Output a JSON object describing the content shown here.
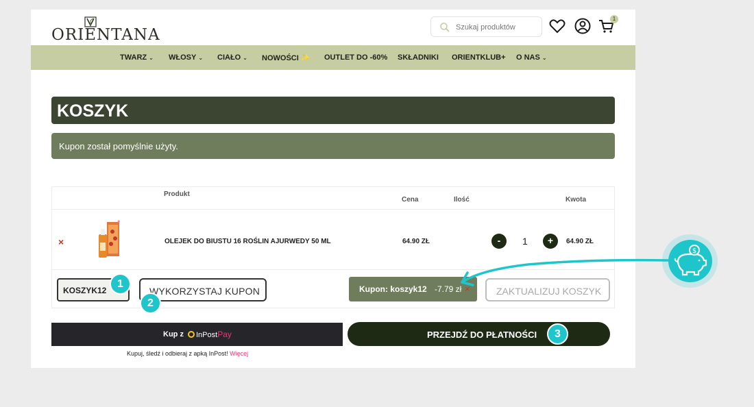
{
  "header": {
    "logo_text": "ORIENTANA",
    "search_placeholder": "Szukaj produktów",
    "cart_count": "1"
  },
  "nav": {
    "items": [
      {
        "label": "TWARZ",
        "dropdown": true
      },
      {
        "label": "WŁOSY",
        "dropdown": true
      },
      {
        "label": "CIAŁO",
        "dropdown": true
      },
      {
        "label": "NOWOŚCI",
        "dropdown": false
      },
      {
        "label": "OUTLET DO -60%",
        "dropdown": false
      },
      {
        "label": "SKŁADNIKI",
        "dropdown": false
      },
      {
        "label": "ORIENTKLUB+",
        "dropdown": false
      },
      {
        "label": "O NAS",
        "dropdown": true
      }
    ]
  },
  "cart": {
    "title": "KOSZYK",
    "notice": "Kupon został pomyślnie użyty.",
    "columns": {
      "product": "Produkt",
      "price": "Cena",
      "quantity": "Ilość",
      "amount": "Kwota"
    },
    "rows": [
      {
        "remove": "×",
        "name": "OLEJEK DO BIUSTU 16 ROŚLIN AJURWEDY 50 ML",
        "price": "64.90 ZŁ",
        "quantity": "1",
        "amount": "64.90 ZŁ",
        "minus": "-",
        "plus": "+"
      }
    ],
    "coupon_value": "KOSZYK12",
    "apply_label": "WYKORZYSTAJ KUPON",
    "applied_coupon_label": "Kupon: koszyk12",
    "applied_coupon_discount": "-7.79 zł",
    "applied_coupon_remove": "×",
    "update_label": "ZAKTUALIZUJ KOSZYK"
  },
  "checkout": {
    "inpost_prefix": "Kup z",
    "inpost_brand": "InPost",
    "inpost_pay": "Pay",
    "inpost_note": "Kupuj, śledź i odbieraj z apką InPost!",
    "inpost_more": "Więcej",
    "proceed_label": "PRZEJDŹ DO PŁATNOŚCI"
  },
  "annotations": {
    "step1": "1",
    "step2": "2",
    "step3": "3"
  },
  "colors": {
    "nav_bg": "#c7cda2",
    "title_bg": "#3c4531",
    "notice_bg": "#6f7d5c",
    "checkout_bg": "#1e2a14",
    "annotation_teal": "#1ec6cc",
    "remove_red": "#c0392b",
    "inpost_pink": "#e6397c"
  },
  "icons": [
    "search-icon",
    "heart-icon",
    "account-icon",
    "cart-icon",
    "piggy-bank-icon",
    "arrow-icon"
  ]
}
